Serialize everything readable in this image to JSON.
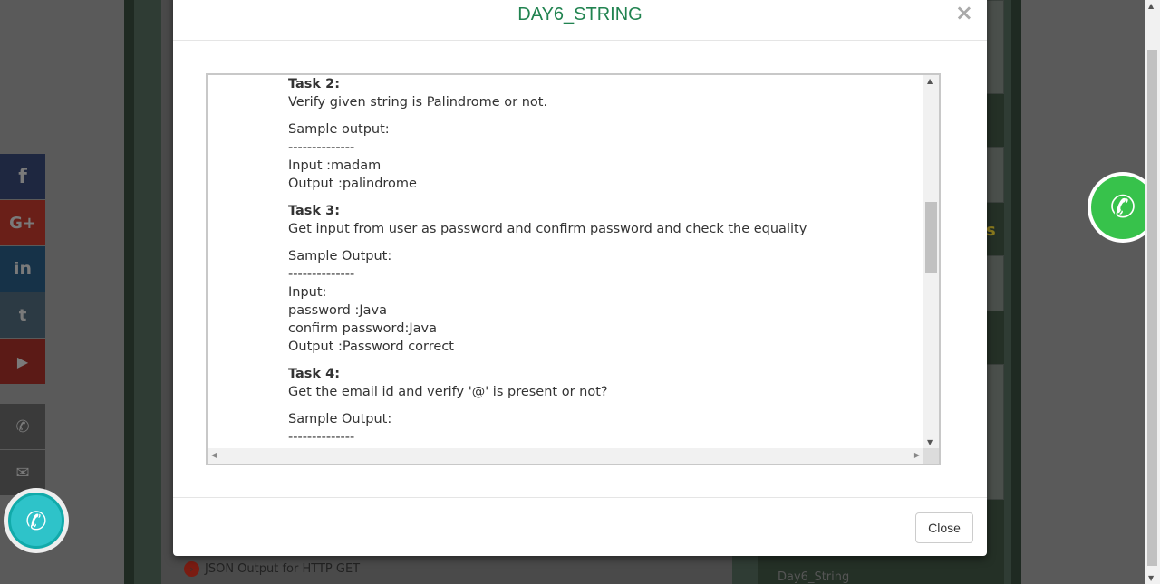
{
  "modal": {
    "title": "DAY6_STRING",
    "close_x": "×",
    "close_label": "Close"
  },
  "content_lines": [
    {
      "bold": "Task 2:",
      "text": ""
    },
    {
      "bold": "",
      "text": "Verify given string is Palindrome or not."
    },
    {
      "gap": true
    },
    {
      "bold": "",
      "text": "Sample output:"
    },
    {
      "bold": "",
      "text": "--------------"
    },
    {
      "bold": "",
      "text": "Input :madam"
    },
    {
      "bold": "",
      "text": "Output :palindrome"
    },
    {
      "gap": true
    },
    {
      "bold": "Task 3:",
      "text": ""
    },
    {
      "bold": "",
      "text": "Get input from user as password and confirm password and check the equality"
    },
    {
      "gap": true
    },
    {
      "bold": "",
      "text": "Sample Output:"
    },
    {
      "bold": "",
      "text": "--------------"
    },
    {
      "bold": "",
      "text": "Input:"
    },
    {
      "bold": "",
      "text": "password :Java"
    },
    {
      "bold": "",
      "text": "confirm password:Java"
    },
    {
      "bold": "",
      "text": "Output :Password correct"
    },
    {
      "gap": true
    },
    {
      "bold": "Task 4:",
      "text": ""
    },
    {
      "bold": "",
      "text": "Get the email id and verify '@' is present or not?"
    },
    {
      "gap": true
    },
    {
      "bold": "",
      "text": "Sample Output:"
    },
    {
      "bold": "",
      "text": "--------------"
    }
  ],
  "background": {
    "link_http_get": "JSON Output for HTTP GET",
    "side_link": "Day6_String",
    "side_heading_fragment": "s"
  },
  "social": {
    "facebook": "f",
    "googleplus": "G+",
    "linkedin": "in",
    "twitter": "t",
    "youtube": "▶",
    "phone": "✆",
    "email": "✉"
  },
  "icons": {
    "call": "✆",
    "whatsapp": "✆"
  },
  "colors": {
    "title": "#218350",
    "whatsapp": "#37c24b",
    "call": "#2ec3c9"
  }
}
